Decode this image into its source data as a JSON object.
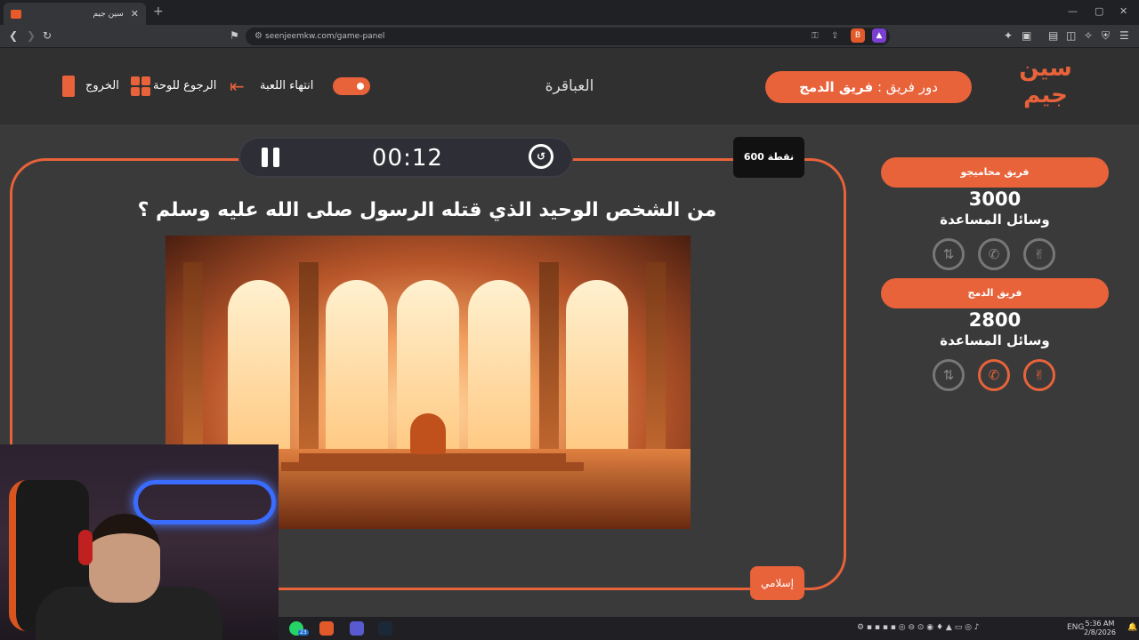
{
  "browser": {
    "tab_title": "سين جيم",
    "tab_close": "✕",
    "new_tab": "+",
    "url": "seenjeemkw.com/game-panel",
    "win_min": "—",
    "win_max": "▢",
    "win_close": "✕"
  },
  "header": {
    "logo_line1": "سين",
    "logo_line2": "جيم",
    "turn_label": "دور فريق :",
    "turn_team": "فريق الدمج",
    "category": "العباقرة",
    "end_game": "انتهاء اللعبة",
    "back_to_board": "الرجوع للوحة",
    "exit": "الخروج"
  },
  "question_panel": {
    "timer": "00:12",
    "points": "600 نقطة",
    "question": "من الشخص الوحيد الذي قتله الرسول صلى الله عليه وسلم ؟",
    "category_tag": "إسلامي"
  },
  "teams": [
    {
      "name": "فريق محاميجو",
      "score": "3000",
      "help_label": "وسائل المساعدة"
    },
    {
      "name": "فريق الدمج",
      "score": "2800",
      "help_label": "وسائل المساعدة"
    }
  ],
  "taskbar": {
    "lang": "ENG",
    "time": "5:36 AM",
    "date": "2/8/2026",
    "whatsapp_badge": "23"
  },
  "colors": {
    "accent": "#e8623a",
    "background": "#3a3a3a",
    "header_bg": "#303030",
    "timer_bg": "#2e2e36"
  }
}
